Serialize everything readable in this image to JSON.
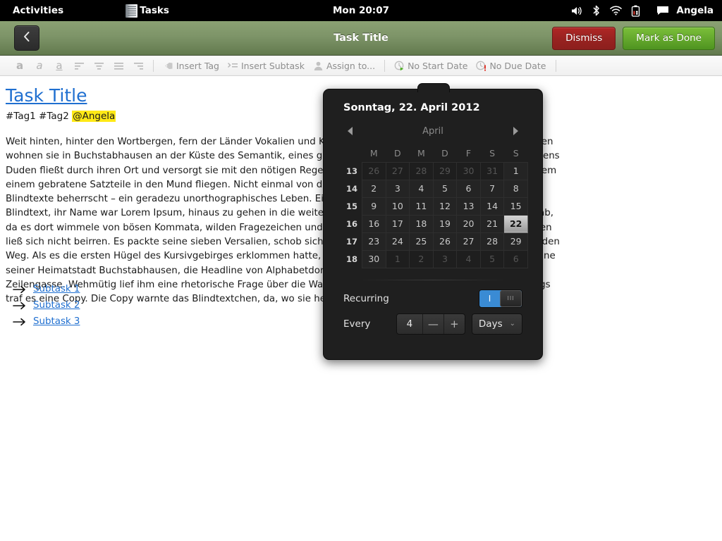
{
  "topbar": {
    "activities": "Activities",
    "app_name": "Tasks",
    "clock": "Mon 20:07",
    "username": "Angela",
    "icons": [
      "volume-icon",
      "bluetooth-icon",
      "wifi-icon",
      "battery-icon",
      "message-icon"
    ]
  },
  "window": {
    "title": "Task Title",
    "back_label": "Back",
    "dismiss_label": "Dismiss",
    "done_label": "Mark as Done"
  },
  "toolbar": {
    "bold": "a",
    "italic": "a",
    "underline": "a",
    "align_left": "align-left-icon",
    "align_center": "align-center-icon",
    "align_justify": "align-justify-icon",
    "align_right": "align-right-icon",
    "insert_tag": "Insert Tag",
    "insert_subtask": "Insert Subtask",
    "assign_to": "Assign to...",
    "no_start_date": "No Start Date",
    "no_due_date": "No Due Date"
  },
  "document": {
    "title": "Task Title",
    "tags": "#Tag1 #Tag2 ",
    "mention": "@Angela",
    "body": "Weit hinten, hinter den Wortbergen, fern der Länder Vokalien und Konsonantien leben die Blindtexte. Abgeschieden wohnen sie in Buchstabhausen an der Küste des Semantik, eines großen Sprachozeans. Ein kleines Bächlein namens Duden fließt durch ihren Ort und versorgt sie mit den nötigen Regelialien. Es ist ein paradiesmatisches Land, in dem einem gebratene Satzteile in den Mund fliegen. Nicht einmal von der allmächtigen Interpunktion werden die Blindtexte beherrscht – ein geradezu unorthographisches Leben. Eines Tages aber beschloß eine kleine Zeile Blindtext, ihr Name war Lorem Ipsum, hinaus zu gehen in die weite Grammatik. Der große Oxmox riet ihr davon ab, da es dort wimmele von bösen Kommata, wilden Fragezeichen und hinterhältigen Semikoli, doch das Blindtextchen ließ sich nicht beirren. Es packte seine sieben Versalien, schob sich sein Initial in den Gürtel und machte sich auf den Weg. Als es die ersten Hügel des Kursivgebirges erklommen hatte, warf es einen letzten Blick zurück auf die Skyline seiner Heimatstadt Buchstabhausen, die Headline von Alphabetdorf und die Subline seiner eigenen Straße, der Zeilengasse. Wehmütig lief ihm eine rhetorische Frage über die Wange, dann setzte es seinen Weg fort. Unterwegs traf es eine Copy. Die Copy warnte das Blindtextchen, da, wo sie herkäme wäre sie",
    "subtasks": [
      "Subtask 1",
      "Subtask 2",
      "Subtask 3"
    ]
  },
  "popup": {
    "selected_date_label": "Sonntag, 22. April 2012",
    "month": "April",
    "prev_label": "prev-month-arrow",
    "next_label": "next-month-arrow",
    "weekday_headers": [
      "M",
      "D",
      "M",
      "D",
      "F",
      "S",
      "S"
    ],
    "weeks": [
      {
        "number": "13",
        "days": [
          {
            "d": "26",
            "other": true
          },
          {
            "d": "27",
            "other": true
          },
          {
            "d": "28",
            "other": true
          },
          {
            "d": "29",
            "other": true
          },
          {
            "d": "30",
            "other": true
          },
          {
            "d": "31",
            "other": true
          },
          {
            "d": "1",
            "other": false
          }
        ]
      },
      {
        "number": "14",
        "days": [
          {
            "d": "2"
          },
          {
            "d": "3"
          },
          {
            "d": "4"
          },
          {
            "d": "5"
          },
          {
            "d": "6"
          },
          {
            "d": "7"
          },
          {
            "d": "8"
          }
        ]
      },
      {
        "number": "15",
        "days": [
          {
            "d": "9"
          },
          {
            "d": "10"
          },
          {
            "d": "11"
          },
          {
            "d": "12"
          },
          {
            "d": "13"
          },
          {
            "d": "14"
          },
          {
            "d": "15"
          }
        ]
      },
      {
        "number": "16",
        "days": [
          {
            "d": "16"
          },
          {
            "d": "17"
          },
          {
            "d": "18"
          },
          {
            "d": "19"
          },
          {
            "d": "20"
          },
          {
            "d": "21"
          },
          {
            "d": "22",
            "selected": true
          }
        ]
      },
      {
        "number": "17",
        "days": [
          {
            "d": "23"
          },
          {
            "d": "24"
          },
          {
            "d": "25"
          },
          {
            "d": "26"
          },
          {
            "d": "27"
          },
          {
            "d": "28"
          },
          {
            "d": "29"
          }
        ]
      },
      {
        "number": "18",
        "days": [
          {
            "d": "30"
          },
          {
            "d": "1",
            "other": true
          },
          {
            "d": "2",
            "other": true
          },
          {
            "d": "3",
            "other": true
          },
          {
            "d": "4",
            "other": true
          },
          {
            "d": "5",
            "other": true
          },
          {
            "d": "6",
            "other": true
          }
        ]
      }
    ],
    "recurring_label": "Recurring",
    "recurring_on": "I",
    "recurring_knob": "III",
    "every_label": "Every",
    "every_value": "4",
    "minus": "—",
    "plus": "+",
    "unit": "Days",
    "unit_caret": "⌄"
  },
  "colors": {
    "accent_blue": "#3a8bd4",
    "link_blue": "#1f6fd0",
    "header_green": "#7d9468",
    "dismiss_red": "#972220",
    "done_green": "#63a72c",
    "mention_highlight": "#ffe916"
  }
}
